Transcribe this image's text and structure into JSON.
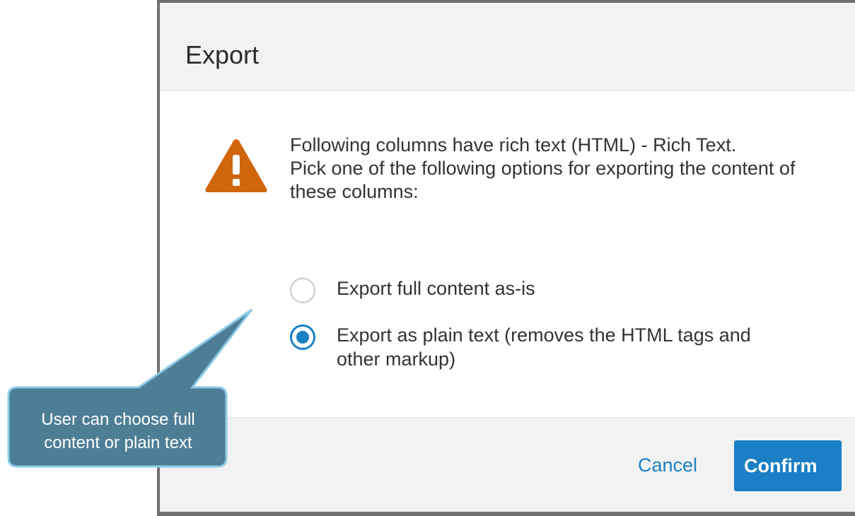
{
  "dialog": {
    "title": "Export",
    "message_line1": "Following columns have rich text (HTML) - Rich Text.",
    "message_line2": "Pick one of the following options for exporting the content of these columns:",
    "options": [
      {
        "label": "Export full content as-is",
        "selected": false
      },
      {
        "label": "Export as plain text (removes the HTML tags and other markup)",
        "selected": true
      }
    ],
    "cancel_label": "Cancel",
    "confirm_label": "Confirm",
    "icon": "warning-icon"
  },
  "callout": {
    "line1": "User can choose full",
    "line2": "content or plain text"
  },
  "colors": {
    "accent": "#1a7fc4",
    "warning": "#d0650a",
    "callout_fill": "#4e7e96",
    "callout_border": "#8ccbe8"
  }
}
